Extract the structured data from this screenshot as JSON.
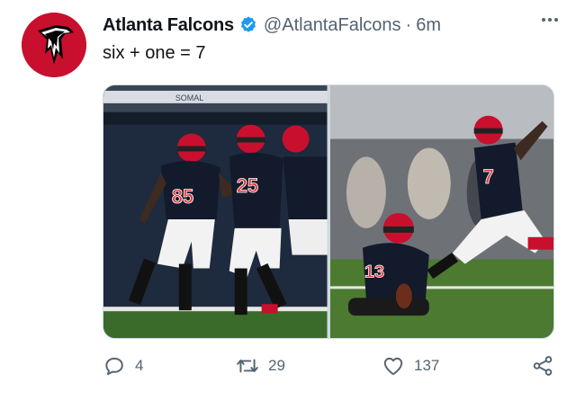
{
  "account": {
    "display_name": "Atlanta Falcons",
    "handle": "@AtlantaFalcons",
    "separator": "·",
    "time": "6m",
    "avatar_icon": "falcon-logo-icon",
    "verified_icon": "verified-badge-icon"
  },
  "tweet": {
    "text": "six + one = 7"
  },
  "media": {
    "photo_1": {
      "jersey_left": "85",
      "jersey_right": "25",
      "banner_text": "SOMAL"
    },
    "photo_2": {
      "jersey_holder": "13",
      "jersey_kicker": "7"
    }
  },
  "actions": {
    "reply_count": "4",
    "retweet_count": "29",
    "like_count": "137",
    "reply_icon": "reply-icon",
    "retweet_icon": "retweet-icon",
    "like_icon": "heart-icon",
    "share_icon": "share-icon"
  },
  "colors": {
    "brand_red": "#c8102e",
    "verified_blue": "#1d9bf0",
    "muted_text": "#536471",
    "text": "#0f1419"
  }
}
